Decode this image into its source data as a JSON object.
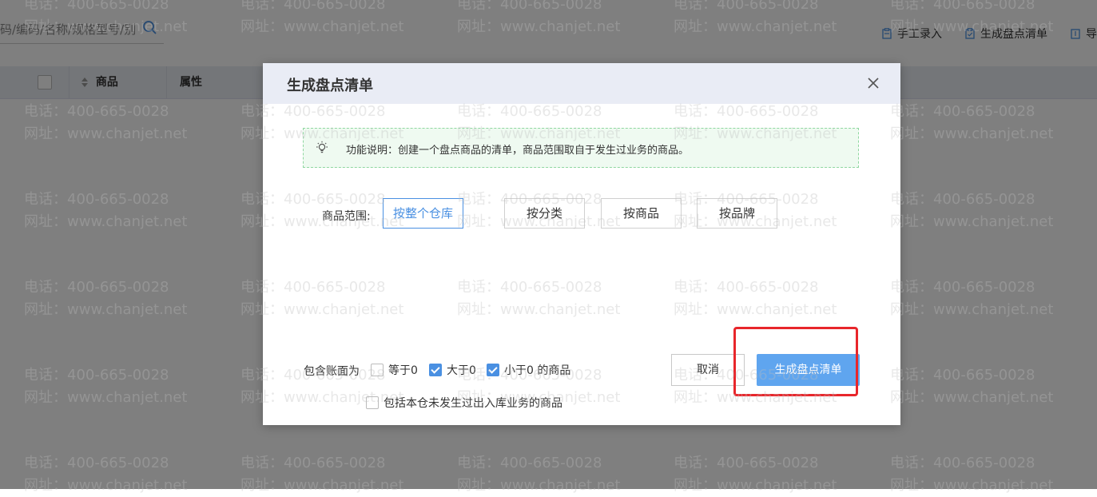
{
  "background": {
    "search": {
      "placeholder": "码/编码/名称/规格型号/别"
    },
    "toolbar": {
      "manual_entry": "手工录入",
      "generate_list": "生成盘点清单",
      "import": "导"
    },
    "table": {
      "col_product": "商品",
      "col_attr": "属性"
    }
  },
  "watermark": {
    "phone": "电话：400-665-0028",
    "site": "网址：www.chanjet.net"
  },
  "dialog": {
    "title": "生成盘点清单",
    "notice": "功能说明：创建一个盘点商品的清单，商品范围取自于发生过业务的商品。",
    "scope_label": "商品范围:",
    "scope_options": [
      "按整个仓库",
      "按分类",
      "按商品",
      "按品牌"
    ],
    "scope_selected": "按整个仓库",
    "include_label": "包含账面为",
    "include_options": [
      {
        "label": "等于0",
        "checked": false
      },
      {
        "label": "大于0",
        "checked": true
      },
      {
        "label": "小于0 的商品",
        "checked": true
      }
    ],
    "include_no_txn": {
      "label": "包括本仓未发生过出入库业务的商品",
      "checked": false
    },
    "cancel_label": "取消",
    "generate_label": "生成盘点清单"
  },
  "colors": {
    "accent": "#4a90e2",
    "primary_button": "#5fa5ef",
    "notice_bg": "#effaf1",
    "notice_border": "#8fd7a0",
    "highlight": "#e8262b",
    "header_bg": "#e9ecf5"
  }
}
